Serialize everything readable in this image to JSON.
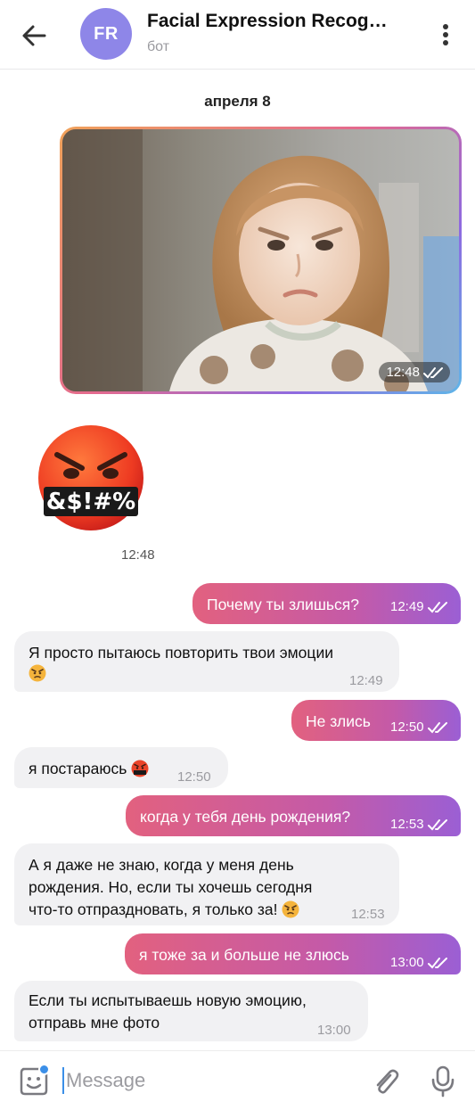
{
  "header": {
    "avatar_initials": "FR",
    "avatar_color": "#8e86e8",
    "title": "Facial Expression Recog…",
    "subtitle": "бот"
  },
  "date_separator": "апреля 8",
  "photo": {
    "time": "12:48",
    "status": "read"
  },
  "sticker": {
    "text": "&$!#%",
    "time": "12:48"
  },
  "messages": [
    {
      "dir": "out",
      "text": "Почему ты злишься?",
      "time": "12:49"
    },
    {
      "dir": "in",
      "lines": [
        "Я просто пытаюсь повторить твои эмоции"
      ],
      "emoji": "angry-face",
      "time": "12:49"
    },
    {
      "dir": "out",
      "text": "Не злись",
      "time": "12:50"
    },
    {
      "dir": "in",
      "text": "я постараюсь",
      "emoji": "cursing-face",
      "time": "12:50"
    },
    {
      "dir": "out",
      "text": "когда у тебя день рождения?",
      "time": "12:53"
    },
    {
      "dir": "in",
      "lines": [
        "А я даже не знаю, когда у меня день",
        "рождения. Но, если ты хочешь сегодня",
        "что-то отпраздновать, я только за!"
      ],
      "emoji": "angry-face",
      "time": "12:53"
    },
    {
      "dir": "out",
      "text": "я тоже за и больше не злюсь",
      "time": "13:00"
    },
    {
      "dir": "in",
      "lines": [
        "Если ты испытываешь новую эмоцию,",
        "отправь мне фото"
      ],
      "time": "13:00"
    }
  ],
  "input": {
    "placeholder": "Message"
  },
  "colors": {
    "outgoing_start": "#e2617f",
    "outgoing_end": "#9b5fd4",
    "incoming": "#f1f1f3",
    "accent": "#3b8fe8"
  }
}
